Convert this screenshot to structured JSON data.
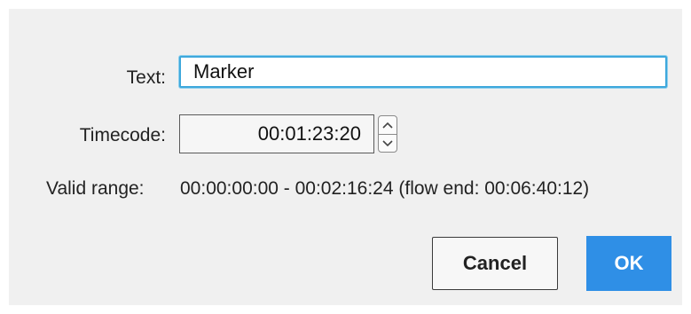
{
  "dialog": {
    "text_label": "Text:",
    "text_value": "Marker",
    "timecode_label": "Timecode:",
    "timecode_value": "00:01:23:20",
    "range_label": "Valid range:",
    "range_value": "00:00:00:00 - 00:02:16:24 (flow end: 00:06:40:12)",
    "cancel_label": "Cancel",
    "ok_label": "OK"
  },
  "icons": {
    "spin_up": "chevron-up-icon",
    "spin_down": "chevron-down-icon"
  },
  "colors": {
    "focus_border": "#3ea8dc",
    "primary_button": "#2f8fe6",
    "dialog_background": "#f0f0f0"
  }
}
